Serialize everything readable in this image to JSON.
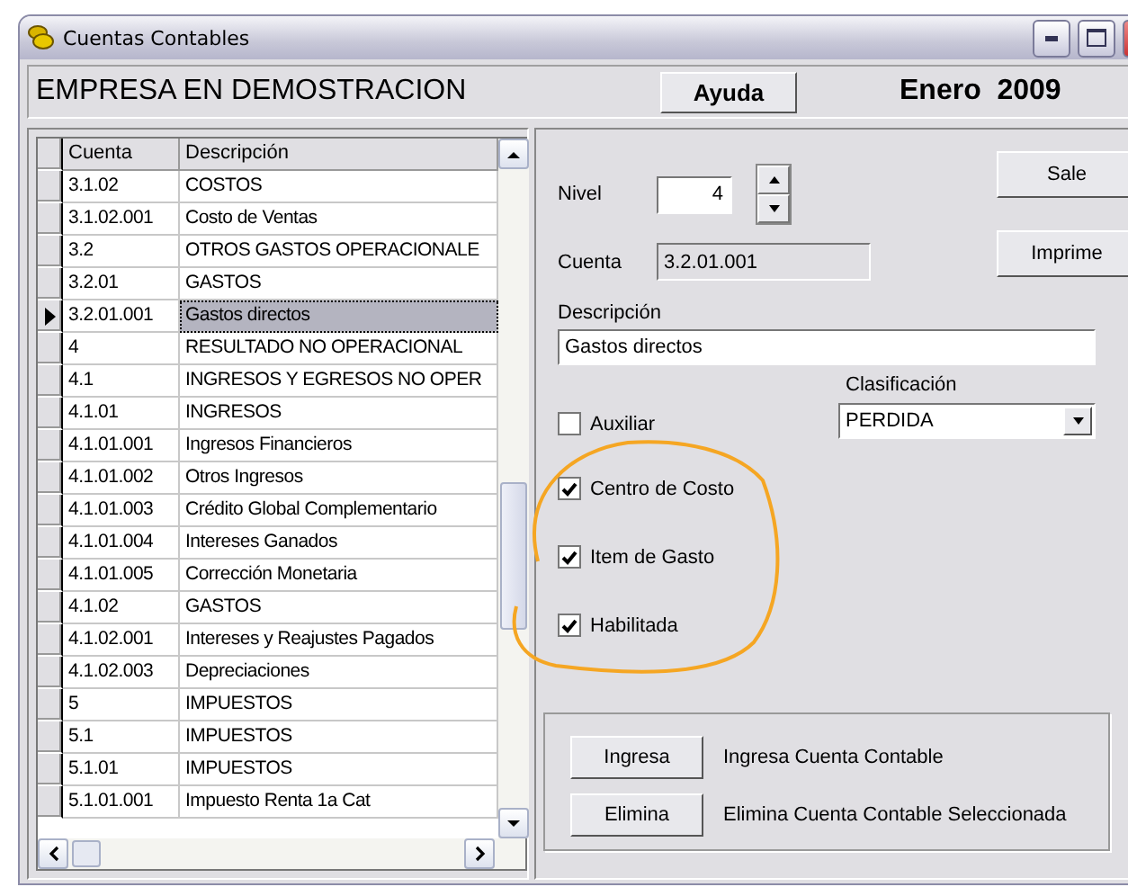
{
  "window": {
    "title": "Cuentas Contables"
  },
  "header": {
    "company": "EMPRESA EN DEMOSTRACION",
    "help_button": "Ayuda",
    "period": "Enero  2009"
  },
  "grid": {
    "columns": [
      "Cuenta",
      "Descripción"
    ],
    "rows": [
      {
        "cuenta": "3.1.02",
        "descripcion": "COSTOS",
        "selected": false
      },
      {
        "cuenta": "3.1.02.001",
        "descripcion": "Costo de Ventas",
        "selected": false
      },
      {
        "cuenta": "3.2",
        "descripcion": "OTROS GASTOS OPERACIONALE",
        "selected": false
      },
      {
        "cuenta": "3.2.01",
        "descripcion": "GASTOS",
        "selected": false
      },
      {
        "cuenta": "3.2.01.001",
        "descripcion": "Gastos directos",
        "selected": true
      },
      {
        "cuenta": "4",
        "descripcion": "RESULTADO NO OPERACIONAL",
        "selected": false
      },
      {
        "cuenta": "4.1",
        "descripcion": "INGRESOS Y EGRESOS NO OPER",
        "selected": false
      },
      {
        "cuenta": "4.1.01",
        "descripcion": "INGRESOS",
        "selected": false
      },
      {
        "cuenta": "4.1.01.001",
        "descripcion": "Ingresos Financieros",
        "selected": false
      },
      {
        "cuenta": "4.1.01.002",
        "descripcion": "Otros Ingresos",
        "selected": false
      },
      {
        "cuenta": "4.1.01.003",
        "descripcion": "Crédito Global Complementario",
        "selected": false
      },
      {
        "cuenta": "4.1.01.004",
        "descripcion": "Intereses Ganados",
        "selected": false
      },
      {
        "cuenta": "4.1.01.005",
        "descripcion": "Corrección Monetaria",
        "selected": false
      },
      {
        "cuenta": "4.1.02",
        "descripcion": "GASTOS",
        "selected": false
      },
      {
        "cuenta": "4.1.02.001",
        "descripcion": "Intereses y Reajustes Pagados",
        "selected": false
      },
      {
        "cuenta": "4.1.02.003",
        "descripcion": "Depreciaciones",
        "selected": false
      },
      {
        "cuenta": "5",
        "descripcion": "IMPUESTOS",
        "selected": false
      },
      {
        "cuenta": "5.1",
        "descripcion": "IMPUESTOS",
        "selected": false
      },
      {
        "cuenta": "5.1.01",
        "descripcion": "IMPUESTOS",
        "selected": false
      },
      {
        "cuenta": "5.1.01.001",
        "descripcion": "Impuesto Renta 1a Cat",
        "selected": false
      }
    ]
  },
  "form": {
    "nivel": {
      "label": "Nivel",
      "value": "4"
    },
    "cuenta": {
      "label": "Cuenta",
      "value": "3.2.01.001"
    },
    "buttons": [
      "Sale",
      "Imprime"
    ],
    "descripcion": {
      "label": "Descripción",
      "value": "Gastos directos"
    },
    "clasificacion": {
      "label": "Clasificación",
      "value": "PERDIDA"
    },
    "checkboxes": [
      {
        "label": "Auxiliar",
        "checked": false
      },
      {
        "label": "Centro de Costo",
        "checked": true
      },
      {
        "label": "Item de Gasto",
        "checked": true
      },
      {
        "label": "Habilitada",
        "checked": true
      }
    ]
  },
  "actions": [
    {
      "button": "Ingresa",
      "description": "Ingresa Cuenta Contable"
    },
    {
      "button": "Elimina",
      "description": "Elimina Cuenta Contable Seleccionada"
    }
  ]
}
